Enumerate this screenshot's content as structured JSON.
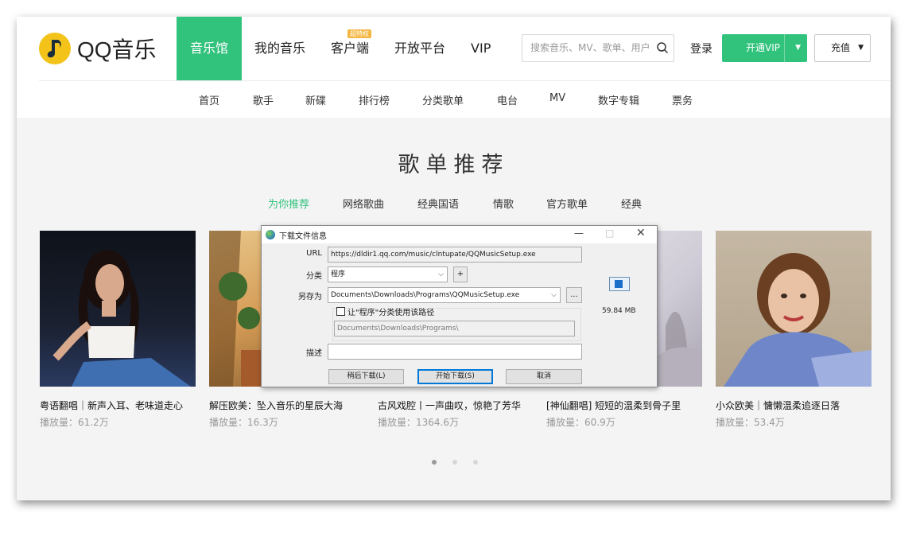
{
  "app": {
    "logo_text": "QQ音乐",
    "brand_color": "#31c27c"
  },
  "main_nav": [
    {
      "label": "音乐馆",
      "active": true
    },
    {
      "label": "我的音乐"
    },
    {
      "label": "客户端",
      "badge": "超特权"
    },
    {
      "label": "开放平台"
    },
    {
      "label": "VIP"
    }
  ],
  "search": {
    "placeholder": "搜索音乐、MV、歌单、用户"
  },
  "header_actions": {
    "login": "登录",
    "vip_button": "开通VIP",
    "recharge": "充值"
  },
  "sub_nav": [
    "首页",
    "歌手",
    "新碟",
    "排行榜",
    "分类歌单",
    "电台",
    "MV",
    "数字专辑",
    "票务"
  ],
  "section": {
    "title": "歌单推荐",
    "tabs": [
      "为你推荐",
      "网络歌曲",
      "经典国语",
      "情歌",
      "官方歌单",
      "经典"
    ],
    "active_tab": 0
  },
  "playlists": [
    {
      "title": "粤语翻唱｜新声入耳、老味道走心",
      "plays": "播放量：61.2万"
    },
    {
      "title": "解压欧美：坠入音乐的星辰大海",
      "plays": "播放量：16.3万"
    },
    {
      "title": "古风戏腔丨一声曲叹，惊艳了芳华",
      "plays": "播放量：1364.6万"
    },
    {
      "title": "[神仙翻唱] 短短的温柔到骨子里",
      "plays": "播放量：60.9万"
    },
    {
      "title": "小众欧美｜慵懒温柔追逐日落",
      "plays": "播放量：53.4万"
    }
  ],
  "carousel": {
    "pages": 3,
    "current": 1
  },
  "dialog": {
    "title": "下载文件信息",
    "url_label": "URL",
    "url_value": "https://dldir1.qq.com/music/clntupate/QQMusicSetup.exe",
    "category_label": "分类",
    "category_value": "程序",
    "add_button": "+",
    "save_as_label": "另存为",
    "save_as_value": "Documents\\Downloads\\Programs\\QQMusicSetup.exe",
    "browse_button": "...",
    "remember_checkbox": "让\"程序\"分类使用该路径",
    "remember_checked": false,
    "default_path": "Documents\\Downloads\\Programs\\",
    "description_label": "描述",
    "description_value": "",
    "file_size": "59.84 MB",
    "btn_later": "稍后下载(L)",
    "btn_start": "开始下载(S)",
    "btn_cancel": "取消"
  }
}
